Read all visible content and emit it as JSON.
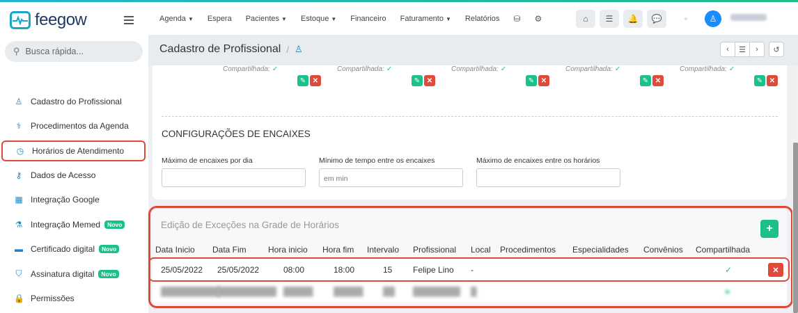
{
  "app": {
    "logo_text": "feegow"
  },
  "search": {
    "placeholder": "Busca rápida..."
  },
  "sidebar": {
    "items": [
      {
        "label": "Cadastro do Profissional",
        "icon": "user-tie-icon",
        "glyph": "♙",
        "novo": false,
        "active": false
      },
      {
        "label": "Procedimentos da Agenda",
        "icon": "stethoscope-icon",
        "glyph": "⚕",
        "novo": false,
        "active": false
      },
      {
        "label": "Horários de Atendimento",
        "icon": "clock-icon",
        "glyph": "◷",
        "novo": false,
        "active": true
      },
      {
        "label": "Dados de Acesso",
        "icon": "key-icon",
        "glyph": "⚷",
        "novo": false,
        "active": false
      },
      {
        "label": "Integração Google",
        "icon": "calendar-icon",
        "glyph": "▦",
        "novo": false,
        "active": false
      },
      {
        "label": "Integração Memed",
        "icon": "flask-icon",
        "glyph": "⚗",
        "novo": true,
        "active": false
      },
      {
        "label": "Certificado digital",
        "icon": "credit-card-icon",
        "glyph": "▬",
        "novo": true,
        "active": false
      },
      {
        "label": "Assinatura digital",
        "icon": "shield-icon",
        "glyph": "⛉",
        "novo": true,
        "active": false
      },
      {
        "label": "Permissões",
        "icon": "lock-icon",
        "glyph": "🔒",
        "novo": false,
        "active": false
      }
    ],
    "novo_label": "Novo"
  },
  "topnav": {
    "items": [
      {
        "label": "Agenda",
        "dropdown": true
      },
      {
        "label": "Espera",
        "dropdown": false
      },
      {
        "label": "Pacientes",
        "dropdown": true
      },
      {
        "label": "Estoque",
        "dropdown": true
      },
      {
        "label": "Financeiro",
        "dropdown": false
      },
      {
        "label": "Faturamento",
        "dropdown": true
      },
      {
        "label": "Relatórios",
        "dropdown": false
      }
    ],
    "icons": [
      "database-icon",
      "gear-icon"
    ],
    "toolbar_icons": [
      {
        "name": "inbox-icon",
        "glyph": "⌂"
      },
      {
        "name": "list-check-icon",
        "glyph": "☰"
      },
      {
        "name": "bell-icon",
        "glyph": "🔔"
      },
      {
        "name": "chat-icon",
        "glyph": "💬"
      }
    ]
  },
  "page": {
    "title": "Cadastro de Profissional",
    "separator": "/",
    "header_buttons": [
      {
        "name": "prev-button",
        "glyph": "‹"
      },
      {
        "name": "list-button",
        "glyph": "☰"
      },
      {
        "name": "next-button",
        "glyph": "›"
      },
      {
        "name": "history-button",
        "glyph": "↺"
      }
    ]
  },
  "shared_columns": {
    "label": "Compartilhada:",
    "count": 5
  },
  "encaixes": {
    "title": "CONFIGURAÇÕES DE ENCAIXES",
    "fields": [
      {
        "label": "Máximo de encaixes por dia",
        "value": "",
        "placeholder": ""
      },
      {
        "label": "Mínimo de tempo entre os encaixes",
        "value": "",
        "placeholder": "em min"
      },
      {
        "label": "Máximo de encaixes entre os horários",
        "value": "",
        "placeholder": ""
      }
    ]
  },
  "excecoes": {
    "title": "Edição de Exceções na Grade de Horários",
    "add_label": "+",
    "columns": [
      "Data Inicio",
      "Data Fim",
      "Hora inicio",
      "Hora fim",
      "Intervalo",
      "Profissional",
      "Local",
      "Procedimentos",
      "Especialidades",
      "Convênios",
      "Compartilhada"
    ],
    "rows": [
      {
        "data_inicio": "25/05/2022",
        "data_fim": "25/05/2022",
        "hora_inicio": "08:00",
        "hora_fim": "18:00",
        "intervalo": "15",
        "profissional": "Felipe Lino",
        "local": "-",
        "procedimentos": "",
        "especialidades": "",
        "convenios": "",
        "compartilhada": true,
        "blurred": false
      }
    ]
  },
  "colors": {
    "accent_green": "#1bc08a",
    "danger_red": "#e04a3a",
    "brand_blue": "#1a86c9",
    "highlight_red": "#dd4a3a"
  }
}
